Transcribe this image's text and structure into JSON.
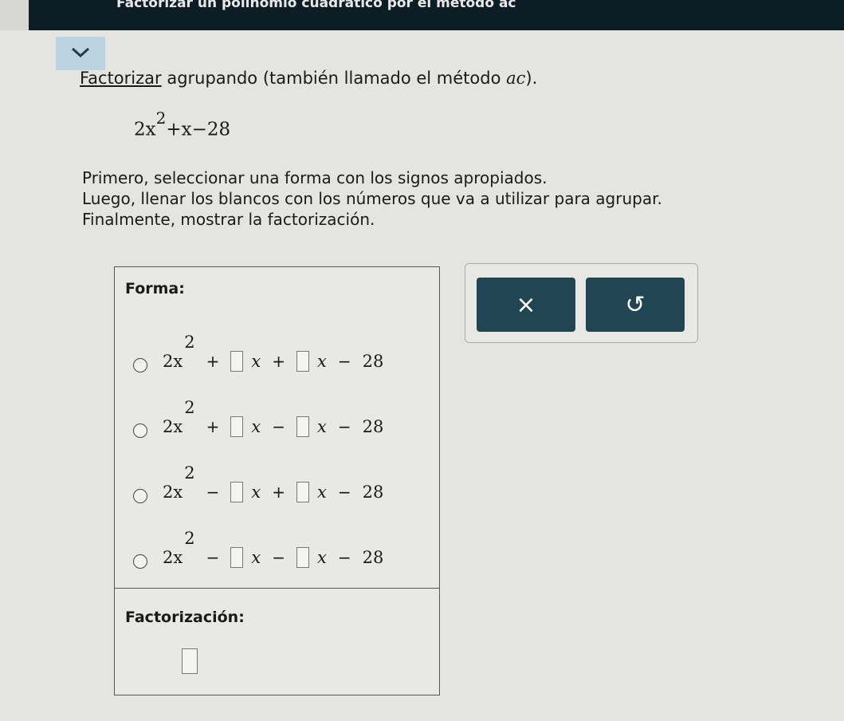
{
  "header": {
    "title": "Factorizar un polinomio cuadrático por el método ac"
  },
  "collapse": {
    "icon": "chevron-down-icon"
  },
  "intro": {
    "link": "Factorizar",
    "text": " agrupando (también llamado el método ",
    "ac": "ac",
    "end": ")."
  },
  "polynomial": {
    "lead": "2x",
    "exp": "2",
    "rest": "+x−28"
  },
  "instructions": {
    "line1": "Primero, seleccionar una forma con los signos apropiados.",
    "line2": "Luego, llenar los blancos con los números que va a utilizar para agrupar.",
    "line3": "Finalmente, mostrar la factorización."
  },
  "panel": {
    "forma_label": "Forma:",
    "factorizacion_label": "Factorización:",
    "options": [
      {
        "lead": "2x",
        "exp": "2",
        "op1": "+",
        "var1": "x",
        "op2": "+",
        "var2": "x",
        "op3": "−",
        "const": "28"
      },
      {
        "lead": "2x",
        "exp": "2",
        "op1": "+",
        "var1": "x",
        "op2": "−",
        "var2": "x",
        "op3": "−",
        "const": "28"
      },
      {
        "lead": "2x",
        "exp": "2",
        "op1": "−",
        "var1": "x",
        "op2": "+",
        "var2": "x",
        "op3": "−",
        "const": "28"
      },
      {
        "lead": "2x",
        "exp": "2",
        "op1": "−",
        "var1": "x",
        "op2": "−",
        "var2": "x",
        "op3": "−",
        "const": "28"
      }
    ]
  },
  "tools": {
    "clear_symbol": "×",
    "undo_symbol": "↺"
  }
}
